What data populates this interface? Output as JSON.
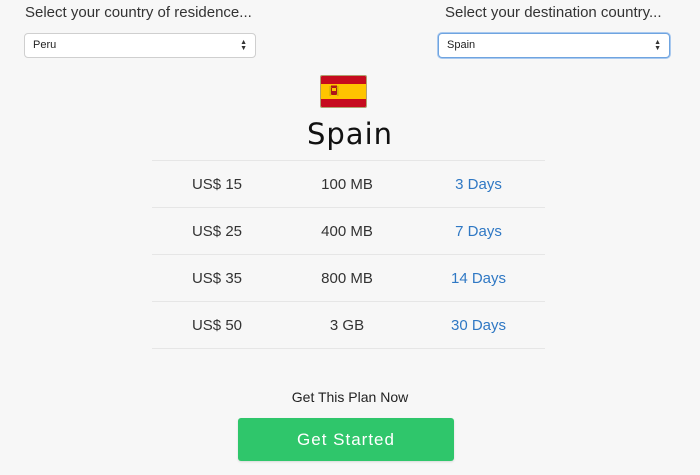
{
  "residence": {
    "label": "Select your country of residence...",
    "selected": "Peru"
  },
  "destination": {
    "label": "Select your destination country...",
    "selected": "Spain"
  },
  "country": {
    "name": "Spain",
    "flag_icon": "spain-flag-icon"
  },
  "plans": [
    {
      "price": "US$ 15",
      "data": "100 MB",
      "duration": "3 Days"
    },
    {
      "price": "US$ 25",
      "data": "400 MB",
      "duration": "7 Days"
    },
    {
      "price": "US$ 35",
      "data": "800 MB",
      "duration": "14 Days"
    },
    {
      "price": "US$ 50",
      "data": "3 GB",
      "duration": "30 Days"
    }
  ],
  "cta": {
    "text": "Get This Plan Now",
    "button_label": "Get Started"
  },
  "colors": {
    "accent_green": "#2fc66b",
    "link_blue": "#2f78c4",
    "background": "#f7f7f7"
  }
}
